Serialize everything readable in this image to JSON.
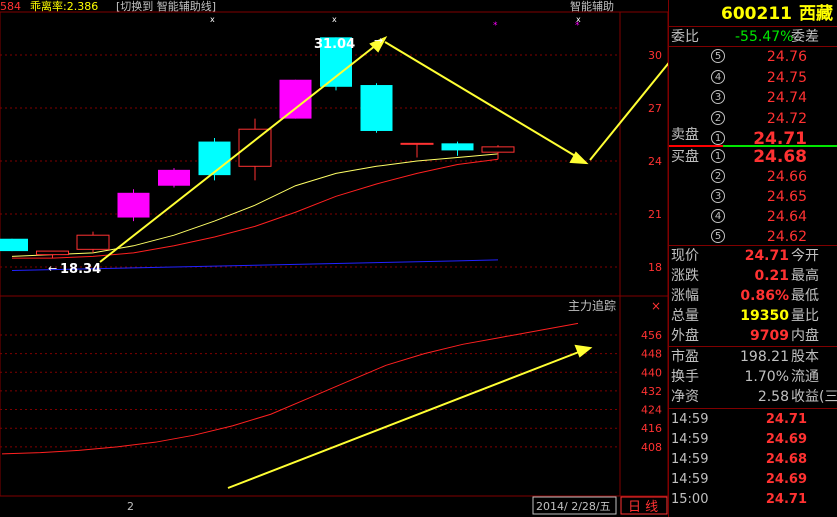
{
  "top_bar": {
    "left_code": "584",
    "indicator_text": "乖离率:2.386",
    "switch_text": "[切换到 智能辅助线]",
    "assist_label": "智能辅助"
  },
  "price_chart": {
    "high_label": "31.04",
    "low_label": "18.34",
    "y_ticks": [
      "30",
      "27",
      "24",
      "21",
      "18"
    ],
    "candles": [
      {
        "o": 18.9,
        "c": 19.6,
        "h": 19.6,
        "l": 18.9,
        "color": "cyan"
      },
      {
        "o": 18.7,
        "c": 18.9,
        "h": 18.9,
        "l": 18.5,
        "color": "red"
      },
      {
        "o": 19.0,
        "c": 19.8,
        "h": 20.0,
        "l": 18.8,
        "color": "red"
      },
      {
        "o": 20.8,
        "c": 22.2,
        "h": 22.4,
        "l": 20.6,
        "color": "magenta"
      },
      {
        "o": 22.6,
        "c": 23.5,
        "h": 23.6,
        "l": 22.5,
        "color": "magenta"
      },
      {
        "o": 23.2,
        "c": 25.1,
        "h": 25.3,
        "l": 22.9,
        "color": "cyan"
      },
      {
        "o": 23.7,
        "c": 25.8,
        "h": 26.4,
        "l": 22.9,
        "color": "red"
      },
      {
        "o": 26.4,
        "c": 28.6,
        "h": 28.6,
        "l": 26.4,
        "color": "magenta"
      },
      {
        "o": 31.0,
        "c": 28.2,
        "h": 31.0,
        "l": 28.0,
        "color": "cyan"
      },
      {
        "o": 28.3,
        "c": 25.7,
        "h": 28.4,
        "l": 25.6,
        "color": "cyan"
      },
      {
        "o": 25.0,
        "c": 25.0,
        "h": 25.0,
        "l": 24.2,
        "color": "red"
      },
      {
        "o": 25.0,
        "c": 24.6,
        "h": 25.1,
        "l": 24.3,
        "color": "cyan"
      },
      {
        "o": 24.5,
        "c": 24.8,
        "h": 24.9,
        "l": 24.1,
        "color": "red"
      }
    ],
    "ma_short": [
      18.6,
      18.7,
      18.8,
      19.2,
      19.8,
      20.6,
      21.5,
      22.6,
      23.3,
      23.7,
      24.0,
      24.2,
      24.4
    ],
    "ma_mid": [
      18.5,
      18.5,
      18.6,
      18.8,
      19.2,
      19.7,
      20.3,
      21.1,
      22.0,
      22.7,
      23.3,
      23.8,
      24.1
    ],
    "ma_long": [
      17.8,
      17.85,
      17.9,
      17.95,
      18.0,
      18.05,
      18.1,
      18.15,
      18.2,
      18.25,
      18.3,
      18.35,
      18.4
    ]
  },
  "sub_chart": {
    "title": "主力追踪",
    "y_ticks": [
      "456",
      "448",
      "440",
      "432",
      "424",
      "416",
      "408"
    ],
    "line": [
      405,
      405.5,
      406.5,
      408,
      410,
      413,
      417,
      422,
      429,
      436,
      443,
      448,
      452,
      455,
      458,
      461
    ]
  },
  "bottom_bar": {
    "marker": "2",
    "date": "2014/ 2/28/五",
    "period": "日 线"
  },
  "quote": {
    "code": "600211",
    "name": "西藏",
    "wei_bi_label": "委比",
    "wei_bi": "-55.47%",
    "wei_cha_label": "委差",
    "sell_label": "卖盘",
    "buy_label": "买盘",
    "asks": [
      {
        "level": "5",
        "price": "24.76"
      },
      {
        "level": "4",
        "price": "24.75"
      },
      {
        "level": "3",
        "price": "24.74"
      },
      {
        "level": "2",
        "price": "24.72"
      },
      {
        "level": "1",
        "price": "24.71"
      }
    ],
    "bids": [
      {
        "level": "1",
        "price": "24.68"
      },
      {
        "level": "2",
        "price": "24.66"
      },
      {
        "level": "3",
        "price": "24.65"
      },
      {
        "level": "4",
        "price": "24.64"
      },
      {
        "level": "5",
        "price": "24.62"
      }
    ],
    "stats": [
      {
        "l1": "现价",
        "v1": "24.71",
        "l2": "今开",
        "c": "red"
      },
      {
        "l1": "涨跌",
        "v1": "0.21",
        "l2": "最高",
        "c": "red"
      },
      {
        "l1": "涨幅",
        "v1": "0.86%",
        "l2": "最低",
        "c": "red"
      },
      {
        "l1": "总量",
        "v1": "19350",
        "l2": "量比",
        "c": "yel"
      },
      {
        "l1": "外盘",
        "v1": "9709",
        "l2": "内盘",
        "c": "red"
      }
    ],
    "stats2": [
      {
        "l1": "市盈",
        "v1": "198.21",
        "l2": "股本"
      },
      {
        "l1": "换手",
        "v1": "1.70%",
        "l2": "流通"
      },
      {
        "l1": "净资",
        "v1": "2.58",
        "l2": "收益(三"
      }
    ],
    "ticks": [
      {
        "time": "14:59",
        "price": "24.71"
      },
      {
        "time": "14:59",
        "price": "24.69"
      },
      {
        "time": "14:59",
        "price": "24.68"
      },
      {
        "time": "14:59",
        "price": "24.69"
      },
      {
        "time": "15:00",
        "price": "24.71"
      }
    ]
  },
  "colors": {
    "red": "#ff3232",
    "cyan": "#00ffff",
    "magenta": "#ff00ff",
    "yellow": "#ffff00",
    "arrow": "#ffff33",
    "grid": "#800000",
    "ma_short": "#ffff66",
    "ma_mid": "#ff2020",
    "ma_long": "#2222ff"
  }
}
